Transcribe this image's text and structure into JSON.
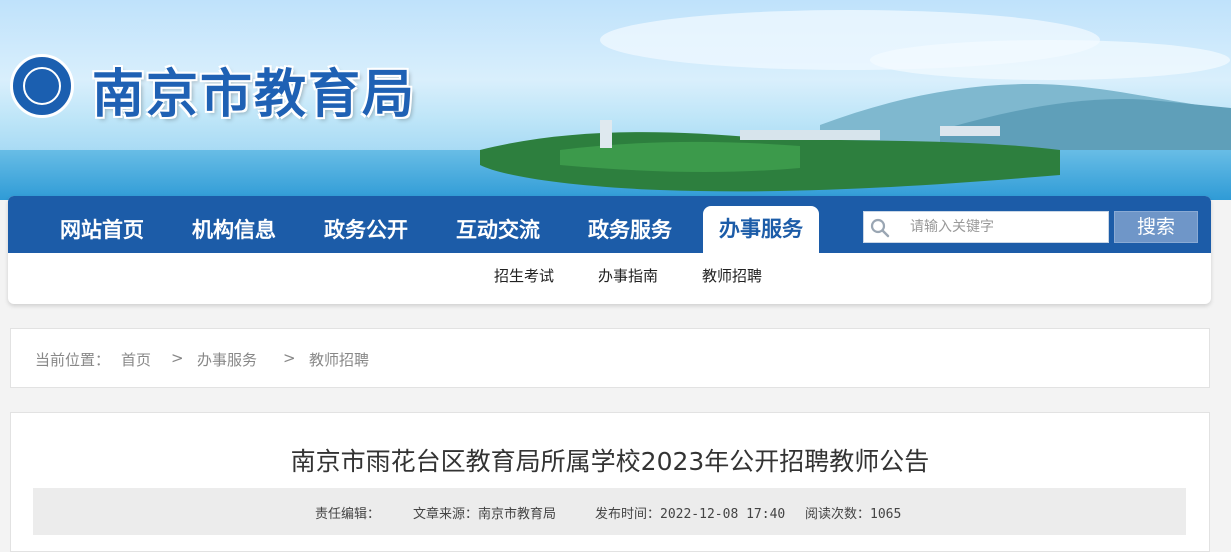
{
  "site": {
    "title": "南京市教育局"
  },
  "nav": {
    "items": [
      {
        "label": "网站首页"
      },
      {
        "label": "机构信息"
      },
      {
        "label": "政务公开"
      },
      {
        "label": "互动交流"
      },
      {
        "label": "政务服务"
      },
      {
        "label": "办事服务"
      }
    ],
    "active": "办事服务"
  },
  "search": {
    "placeholder": "请输入关键字",
    "button": "搜索"
  },
  "subnav": {
    "items": [
      {
        "label": "招生考试"
      },
      {
        "label": "办事指南"
      },
      {
        "label": "教师招聘"
      }
    ]
  },
  "breadcrumb": {
    "prefix": "当前位置：",
    "items": [
      {
        "label": "首页"
      },
      {
        "label": "办事服务"
      },
      {
        "label": "教师招聘"
      }
    ],
    "separator": ">"
  },
  "article": {
    "title": "南京市雨花台区教育局所属学校2023年公开招聘教师公告",
    "meta": {
      "editor": "责任编辑：",
      "source": "文章来源：南京市教育局",
      "published": "发布时间：2022-12-08 17:40",
      "views": "阅读次数：1065"
    }
  },
  "colors": {
    "nav_blue": "#1c5ca8",
    "search_button": "#6f96c8"
  },
  "icons": {
    "search": "search-icon",
    "logo": "logo-emblem"
  }
}
